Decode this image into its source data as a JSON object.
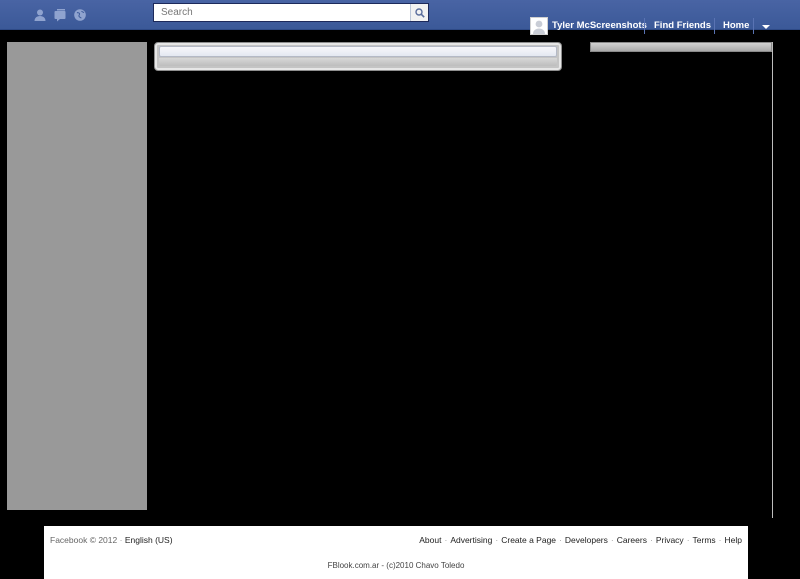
{
  "header": {
    "jewels": [
      {
        "icon": "friend-requests-icon"
      },
      {
        "icon": "messages-icon"
      },
      {
        "icon": "notifications-globe-icon"
      }
    ],
    "search": {
      "placeholder": "Search",
      "icon": "magnifier-icon"
    },
    "user_name": "Tyler McScreenshots",
    "find_friends": "Find Friends",
    "home": "Home",
    "menu_icon": "chevron-down-icon"
  },
  "footer": {
    "copyright": "Facebook © 2012",
    "separator": "·",
    "language": "English (US)",
    "links": [
      "About",
      "Advertising",
      "Create a Page",
      "Developers",
      "Careers",
      "Privacy",
      "Terms",
      "Help"
    ],
    "credit": "FBlook.com.ar - (c)2010 Chavo Toledo"
  },
  "colors": {
    "topbar": "#3b5998",
    "background": "#000000",
    "left_column": "#999999"
  }
}
